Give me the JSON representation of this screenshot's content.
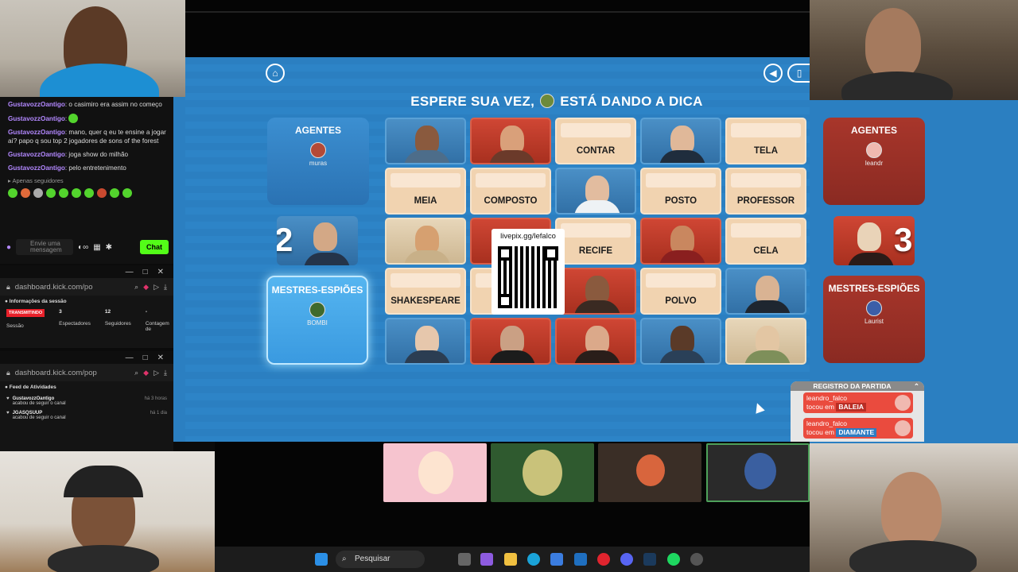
{
  "chat": {
    "messages": [
      {
        "user": "GustavozzOantigo",
        "text": ": o casimiro era assim no começo"
      },
      {
        "user": "GustavozzOantigo",
        "text": ":"
      },
      {
        "user": "GustavozzOantigo",
        "text": ": mano, quer q eu te ensine a jogar aí? papo q sou top 2 jogadores de sons of the forest"
      },
      {
        "user": "GustavozzOantigo",
        "text": ": joga show do milhão"
      },
      {
        "user": "GustavozzOantigo",
        "text": ": pelo entretenimento"
      }
    ],
    "followers_only": "Apenas seguidores",
    "input_placeholder": "Envie uma mensagem",
    "chat_button": "Chat"
  },
  "dashboard1": {
    "url": "dashboard.kick.com/po",
    "section": "Informações da sessão",
    "live_badge": "TRANSMITINDO",
    "session_label": "Sessão",
    "viewers_value": "3",
    "viewers_label": "Espectadores",
    "followers_value": "12",
    "followers_label": "Seguidores",
    "count_value": "-",
    "count_label": "Contagem de"
  },
  "dashboard2": {
    "url": "dashboard.kick.com/pop",
    "section": "Feed de Atividades",
    "feed": [
      {
        "user": "GustavozzOantigo",
        "action": "acabou de seguir o canal",
        "time": "há 3 horas"
      },
      {
        "user": "JGASQSUUP",
        "action": "acabou de seguir o canal",
        "time": "há 1 dia"
      }
    ]
  },
  "game": {
    "title_before": "ESPERE SUA VEZ,",
    "title_after": "ESTÁ DANDO A DICA",
    "blue_team": {
      "agents_label": "AGENTES",
      "agent_player": "muras",
      "score": "2",
      "spymasters_label": "MESTRES-ESPIÕES",
      "spymaster_player": "BOMBI"
    },
    "red_team": {
      "agents_label": "AGENTES",
      "agent_player": "leandr",
      "score": "3",
      "spymasters_label": "MESTRES-ESPIÕES",
      "spymaster_player": "Laurist"
    },
    "words": [
      "CONTAR",
      "TELA",
      "MEIA",
      "COMPOSTO",
      "POSTO",
      "PROFESSOR",
      "RECIFE",
      "CELA",
      "SHAKESPEARE",
      "POLVO"
    ],
    "qr_url": "livepix.gg/lefalco",
    "log": {
      "title": "REGISTRO DA PARTIDA",
      "entries": [
        {
          "player": "leandro_falco",
          "verb": "tocou em",
          "word": "BALEIA"
        },
        {
          "player": "leandro_falco",
          "verb": "tocou em",
          "word": "DIAMANTE"
        }
      ]
    }
  },
  "taskbar": {
    "search_placeholder": "Pesquisar"
  },
  "colors": {
    "board_blue": "#2b7fc1",
    "red_team": "#a8362b",
    "word_card": "#f1d3b0",
    "kick_green": "#53fc18"
  }
}
